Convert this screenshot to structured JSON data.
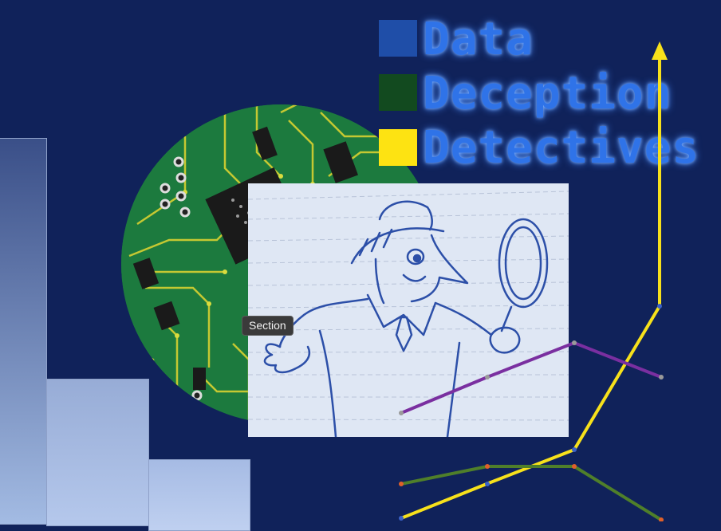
{
  "title": {
    "words": [
      "Data",
      "Deception",
      "Detectives"
    ]
  },
  "tooltip": {
    "label": "Section"
  },
  "colors": {
    "background": "#10225a",
    "square_blue": "#1f4ea8",
    "square_green": "#124a1f",
    "square_yellow": "#fde312",
    "line_yellow": "#f7e11b",
    "line_purple": "#7a2fa0",
    "line_green": "#4f7f2a"
  },
  "images": {
    "circuit": "circuit-board",
    "sketch": "detective-sketch"
  }
}
